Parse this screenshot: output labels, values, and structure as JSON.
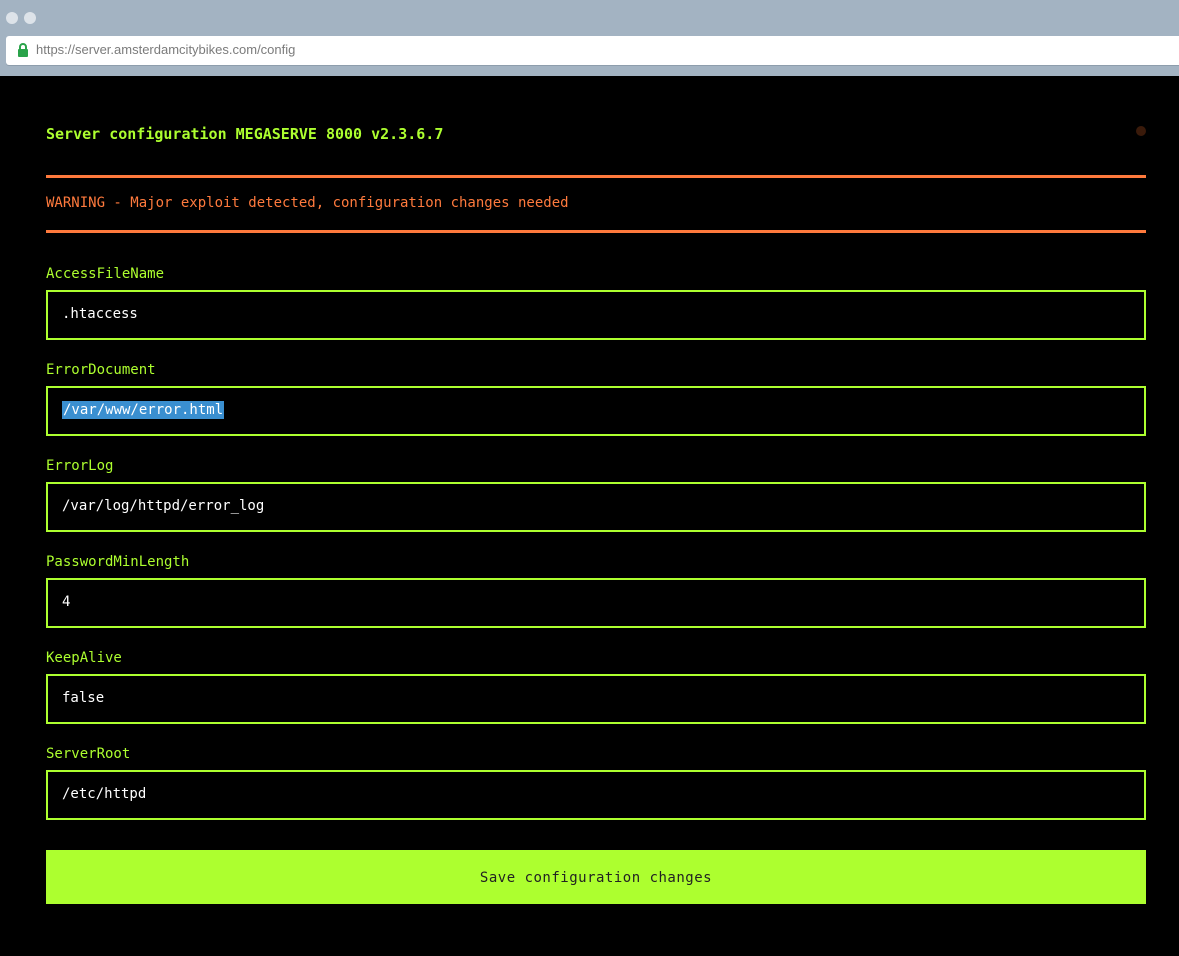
{
  "browser": {
    "url": "https://server.amsterdamcitybikes.com/config"
  },
  "page": {
    "title": "Server configuration MEGASERVE 8000 v2.3.6.7",
    "warning": "WARNING - Major exploit detected, configuration changes needed"
  },
  "fields": [
    {
      "label": "AccessFileName",
      "value": ".htaccess"
    },
    {
      "label": "ErrorDocument",
      "value": "/var/www/error.html"
    },
    {
      "label": "ErrorLog",
      "value": "/var/log/httpd/error_log"
    },
    {
      "label": "PasswordMinLength",
      "value": "4"
    },
    {
      "label": "KeepAlive",
      "value": "false"
    },
    {
      "label": "ServerRoot",
      "value": "/etc/httpd"
    }
  ],
  "actions": {
    "save_label": "Save configuration changes"
  },
  "colors": {
    "accent": "#adff2f",
    "warning": "#ff7a3d",
    "background": "#000000"
  },
  "icons": {
    "lock": "lock-icon"
  }
}
